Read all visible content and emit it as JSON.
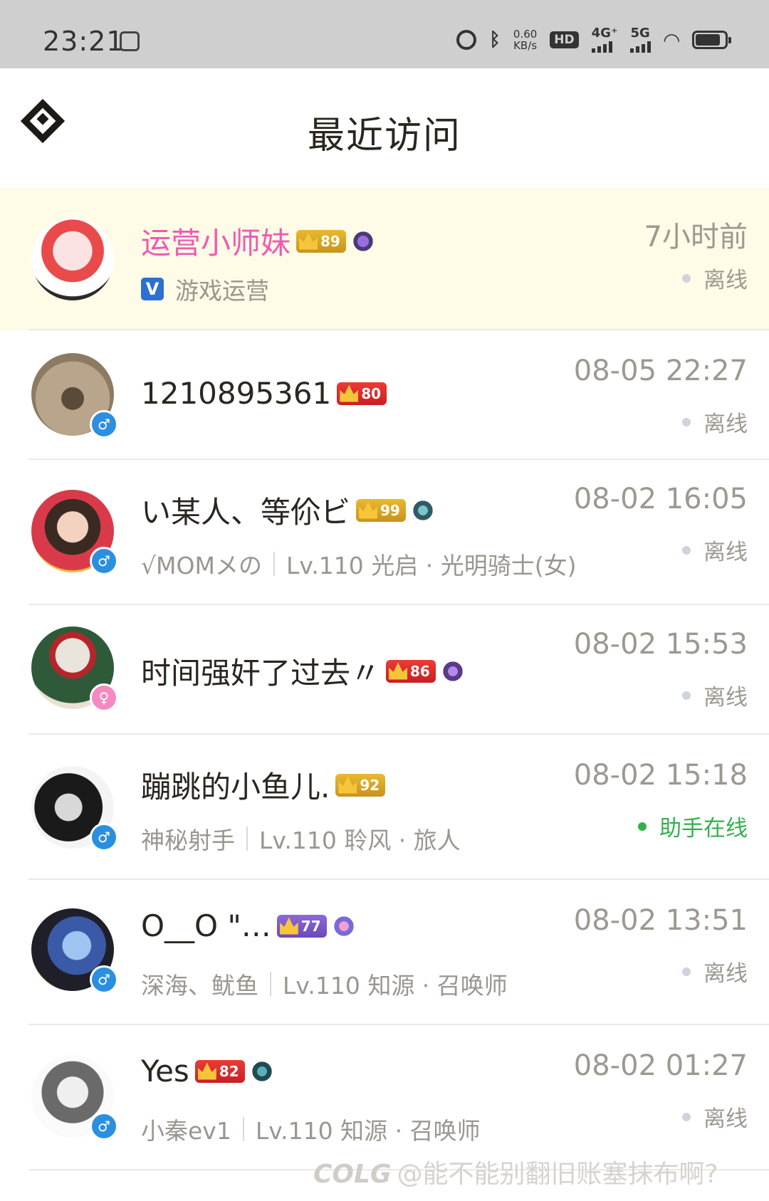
{
  "status_bar": {
    "time": "23:21",
    "speed_value": "0.60",
    "speed_unit": "KB/s",
    "hd": "HD",
    "net1": "4G⁺",
    "net2": "5G"
  },
  "header": {
    "title": "最近访问",
    "back_icon": "diamond-logo-icon"
  },
  "visits": [
    {
      "name": "运营小师妹",
      "level": "89",
      "time": "7小时前",
      "status": "离线",
      "subtitle": "游戏运营",
      "verified_badge": "V",
      "gender": "",
      "highlight": true
    },
    {
      "name": "1210895361",
      "level": "80",
      "time": "08-05 22:27",
      "status": "离线",
      "gender": "♂"
    },
    {
      "name": "い某人、等伱ビ",
      "level": "99",
      "time": "08-02 16:05",
      "status": "离线",
      "gender": "♂",
      "guild": "√MOMメの",
      "role": "Lv.110 光启 · 光明骑士(女)"
    },
    {
      "name": "时间强奸了过去〃",
      "level": "86",
      "time": "08-02 15:53",
      "status": "离线",
      "gender": "♀"
    },
    {
      "name": "蹦跳的小鱼儿.",
      "level": "92",
      "time": "08-02 15:18",
      "status": "助手在线",
      "gender": "♂",
      "guild": "神秘射手",
      "role": "Lv.110 聆风 · 旅人"
    },
    {
      "name": "O__O \"…",
      "level": "77",
      "time": "08-02 13:51",
      "status": "离线",
      "gender": "♂",
      "guild": "深海、鱿鱼",
      "role": "Lv.110 知源 · 召唤师"
    },
    {
      "name": "Yes",
      "level": "82",
      "time": "08-02 01:27",
      "status": "离线",
      "gender": "♂",
      "guild": "小秦ev1",
      "role": "Lv.110 知源 · 召唤师"
    }
  ],
  "watermark": {
    "logo": "COLG",
    "text": "@能不能别翻旧账塞抹布啊?"
  },
  "colors": {
    "highlight_bg": "#fefbe6",
    "name_pink": "#f15ab0",
    "online_green": "#34b04a",
    "level_gold": "#d6a424",
    "level_red": "#d62b2b",
    "level_purple": "#7a58c8"
  }
}
